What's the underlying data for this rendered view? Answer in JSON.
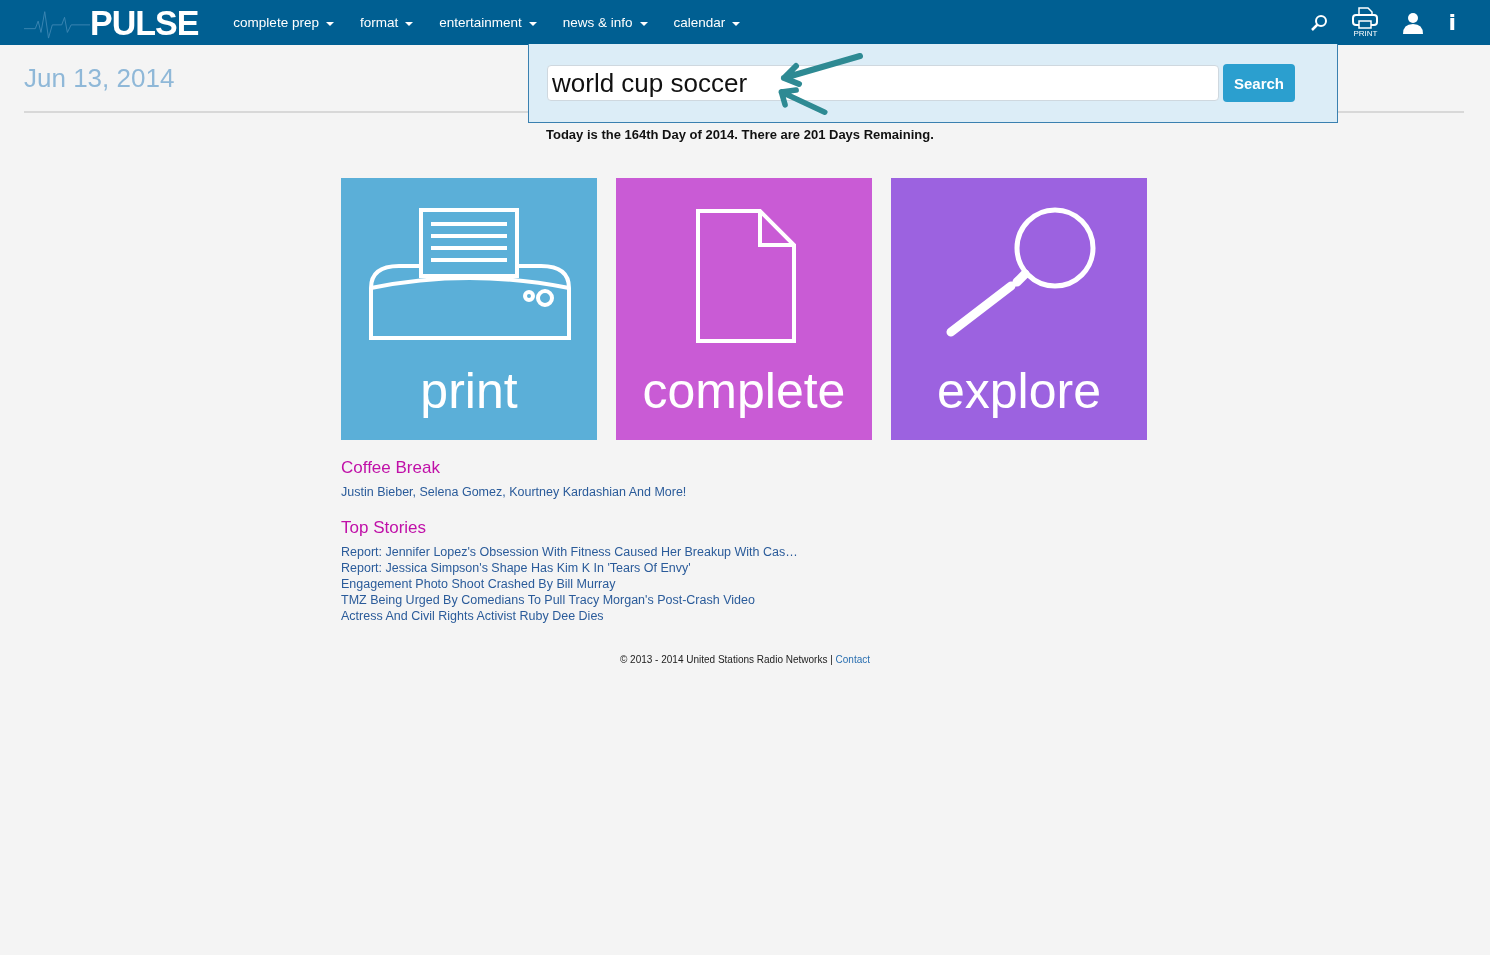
{
  "header": {
    "logo": "PULSE",
    "nav": [
      {
        "label": "complete prep"
      },
      {
        "label": "format"
      },
      {
        "label": "entertainment"
      },
      {
        "label": "news & info"
      },
      {
        "label": "calendar"
      }
    ],
    "print_label": "PRINT",
    "info_label": "i"
  },
  "date": "Jun 13, 2014",
  "search": {
    "value": "world cup soccer",
    "button": "Search"
  },
  "day_note": "Today is the 164th Day of 2014. There are 201 Days Remaining.",
  "tiles": [
    {
      "kind": "print",
      "label": "print",
      "color": "#5bafd8"
    },
    {
      "kind": "complete",
      "label": "complete",
      "color": "#c95bd5"
    },
    {
      "kind": "explore",
      "label": "explore",
      "color": "#9c62e0"
    }
  ],
  "sections": [
    {
      "title": "Coffee Break",
      "links": [
        "Justin Bieber, Selena Gomez, Kourtney Kardashian And More!"
      ]
    },
    {
      "title": "Top Stories",
      "links": [
        "Report: Jennifer Lopez's Obsession With Fitness Caused Her Breakup With Cas…",
        "Report: Jessica Simpson's Shape Has Kim K In 'Tears Of Envy'",
        "Engagement Photo Shoot Crashed By Bill Murray",
        "TMZ Being Urged By Comedians To Pull Tracy Morgan's Post-Crash Video",
        "Actress And Civil Rights Activist Ruby Dee Dies"
      ]
    }
  ],
  "footer": {
    "text": "© 2013 - 2014 United Stations Radio Networks |",
    "link": "Contact"
  }
}
